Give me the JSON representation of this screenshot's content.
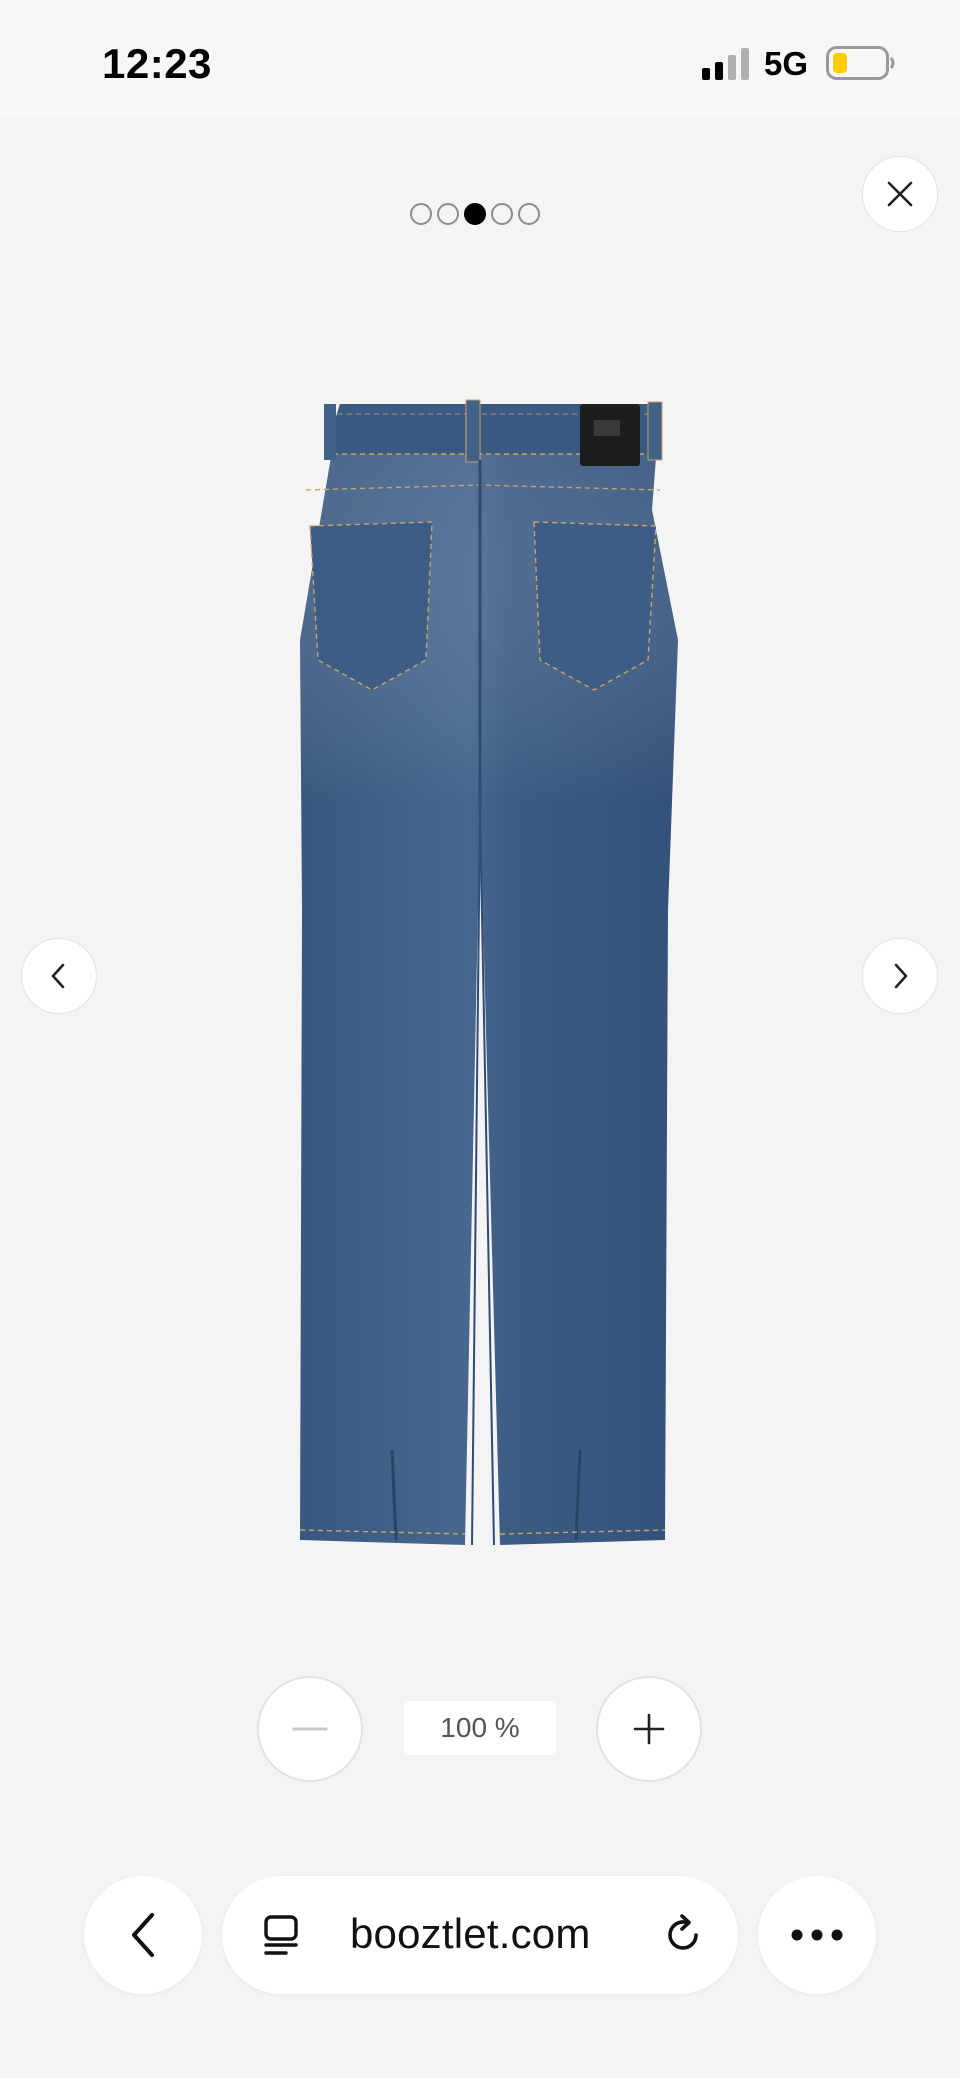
{
  "status_bar": {
    "time": "12:23",
    "network": "5G",
    "icons": [
      "signal-icon",
      "battery-icon"
    ],
    "battery_color": "#ffcc00"
  },
  "gallery": {
    "dot_count": 5,
    "active_index": 2,
    "product_image_icon": "jeans-back-view"
  },
  "zoom": {
    "level_label": "100 %"
  },
  "browser": {
    "url": "booztlet.com",
    "icons": [
      "back-icon",
      "tab-icon",
      "reload-icon",
      "more-icon"
    ]
  },
  "colors": {
    "background": "#f4f4f4",
    "button": "#ffffff",
    "denim": "#3f5f86"
  }
}
